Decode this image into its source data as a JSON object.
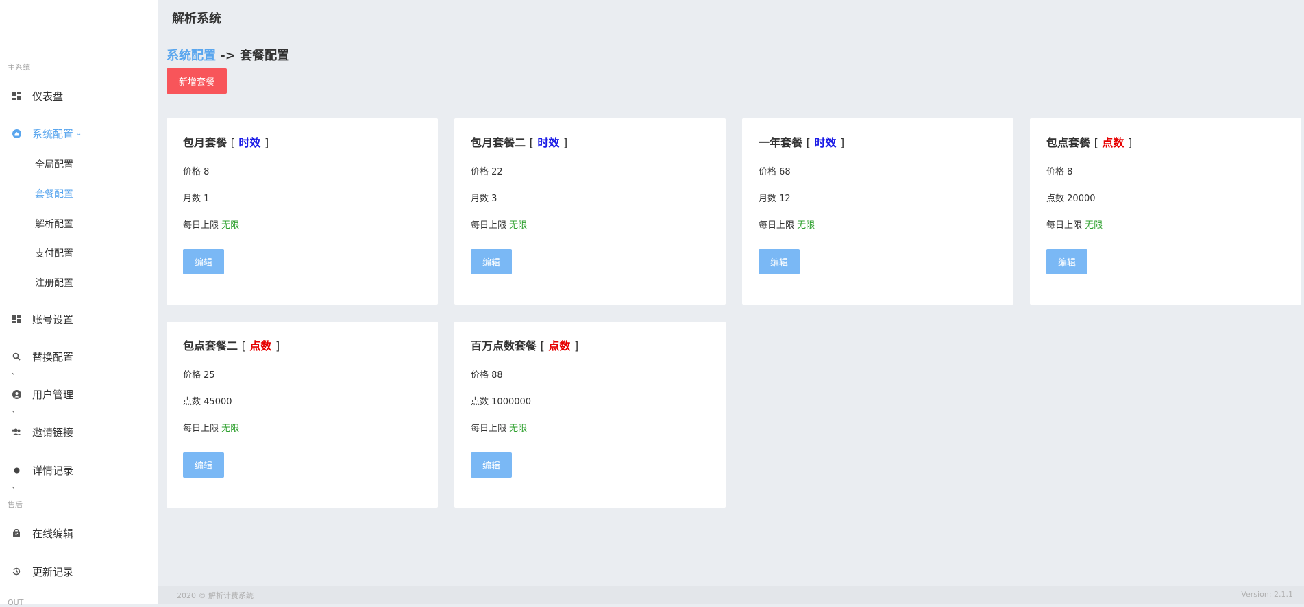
{
  "app": {
    "title": "解析系统"
  },
  "sidebar": {
    "section_main": "主系统",
    "section_after": "售后",
    "section_out": "OUT",
    "items": {
      "dashboard": "仪表盘",
      "sysconfig": "系统配置",
      "account": "账号设置",
      "replace": "替换配置",
      "users": "用户管理",
      "invite": "邀请链接",
      "details": "详情记录",
      "online_edit": "在线编辑",
      "updates": "更新记录"
    },
    "sub_items": {
      "global": "全局配置",
      "package": "套餐配置",
      "parse": "解析配置",
      "payment": "支付配置",
      "register": "注册配置"
    },
    "tick": "、"
  },
  "breadcrumb": {
    "parent": "系统配置",
    "separator": "->",
    "current": "套餐配置"
  },
  "add_button": "新增套餐",
  "cards": [
    {
      "name": "包月套餐",
      "tag": "时效",
      "tag_color": "#1a1ae6",
      "price_label": "价格",
      "price": "8",
      "qty_label": "月数",
      "qty": "1",
      "daily_label": "每日上限",
      "daily_value": "无限",
      "edit": "编辑"
    },
    {
      "name": "包月套餐二",
      "tag": "时效",
      "tag_color": "#1a1ae6",
      "price_label": "价格",
      "price": "22",
      "qty_label": "月数",
      "qty": "3",
      "daily_label": "每日上限",
      "daily_value": "无限",
      "edit": "编辑"
    },
    {
      "name": "一年套餐",
      "tag": "时效",
      "tag_color": "#1a1ae6",
      "price_label": "价格",
      "price": "68",
      "qty_label": "月数",
      "qty": "12",
      "daily_label": "每日上限",
      "daily_value": "无限",
      "edit": "编辑"
    },
    {
      "name": "包点套餐",
      "tag": "点数",
      "tag_color": "#e60000",
      "price_label": "价格",
      "price": "8",
      "qty_label": "点数",
      "qty": "20000",
      "daily_label": "每日上限",
      "daily_value": "无限",
      "edit": "编辑"
    },
    {
      "name": "包点套餐二",
      "tag": "点数",
      "tag_color": "#e60000",
      "price_label": "价格",
      "price": "25",
      "qty_label": "点数",
      "qty": "45000",
      "daily_label": "每日上限",
      "daily_value": "无限",
      "edit": "编辑"
    },
    {
      "name": "百万点数套餐",
      "tag": "点数",
      "tag_color": "#e60000",
      "price_label": "价格",
      "price": "88",
      "qty_label": "点数",
      "qty": "1000000",
      "daily_label": "每日上限",
      "daily_value": "无限",
      "edit": "编辑"
    }
  ],
  "footer": {
    "left": "2020 © 解析计费系统",
    "right": "Version: 2.1.1"
  },
  "colors": {
    "accent": "#5aa6ee",
    "danger": "#f8555a",
    "ok": "#2ea02e"
  }
}
